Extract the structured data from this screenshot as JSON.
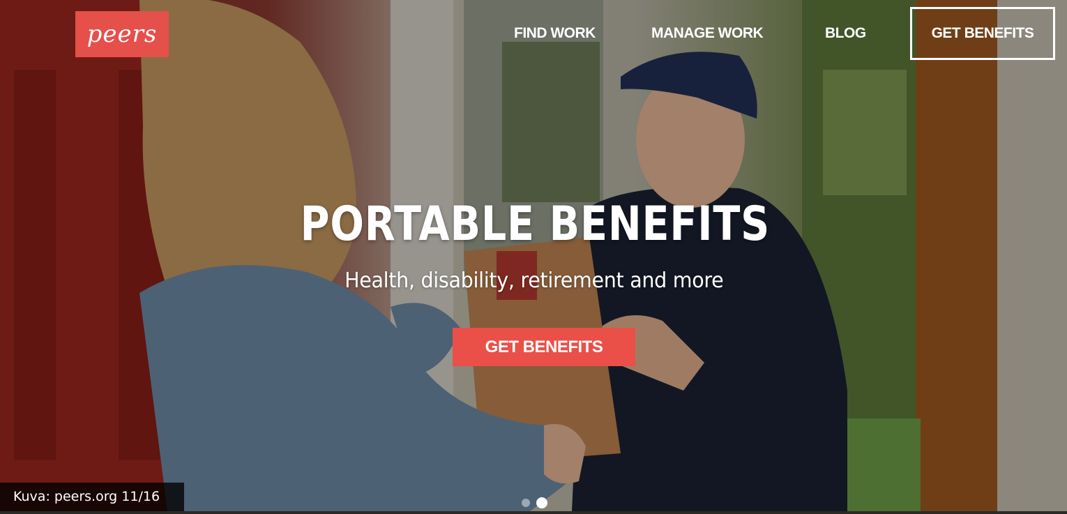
{
  "brand": {
    "logo_text": "peers",
    "color": "#e6504a"
  },
  "nav": {
    "links": [
      "FIND WORK",
      "MANAGE WORK",
      "BLOG"
    ],
    "cta_label": "GET BENEFITS"
  },
  "hero": {
    "headline": "PORTABLE BENEFITS",
    "subheadline": "Health, disability, retirement and more",
    "button_label": "GET BENEFITS",
    "button_color": "#ea4f48",
    "slides": {
      "count": 2,
      "active_index": 2
    }
  },
  "caption": {
    "text": "Kuva: peers.org 11/16"
  }
}
